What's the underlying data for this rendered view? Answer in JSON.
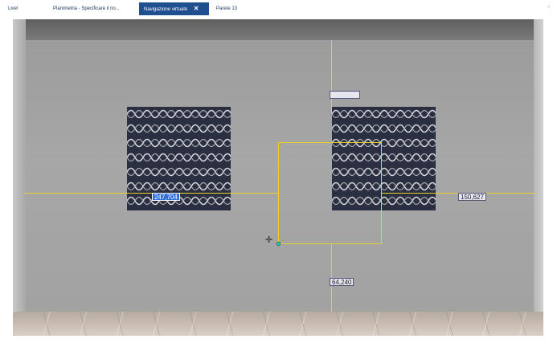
{
  "tabs": [
    {
      "label": "Live!",
      "active": false
    },
    {
      "label": "Planimetria - Specificare il no...",
      "active": false
    },
    {
      "label": "Navigazione virtuale",
      "active": true
    },
    {
      "label": "Parete 13",
      "active": false
    }
  ],
  "tab_close_glyph": "✕",
  "tab_overflow_glyph": "‹",
  "dimensions": {
    "left_width": "247,704",
    "right_offset": "150,627",
    "bottom_offset": "64,240",
    "top_value": ""
  },
  "colors": {
    "active_tab": "#1f4f8f",
    "guide_line": "#e7d02a",
    "selected_dimension": "#2f6fdc",
    "snap_point": "#24e0c6"
  },
  "icons": {
    "cursor": "move-crosshair-icon",
    "snap": "snap-point-icon"
  }
}
